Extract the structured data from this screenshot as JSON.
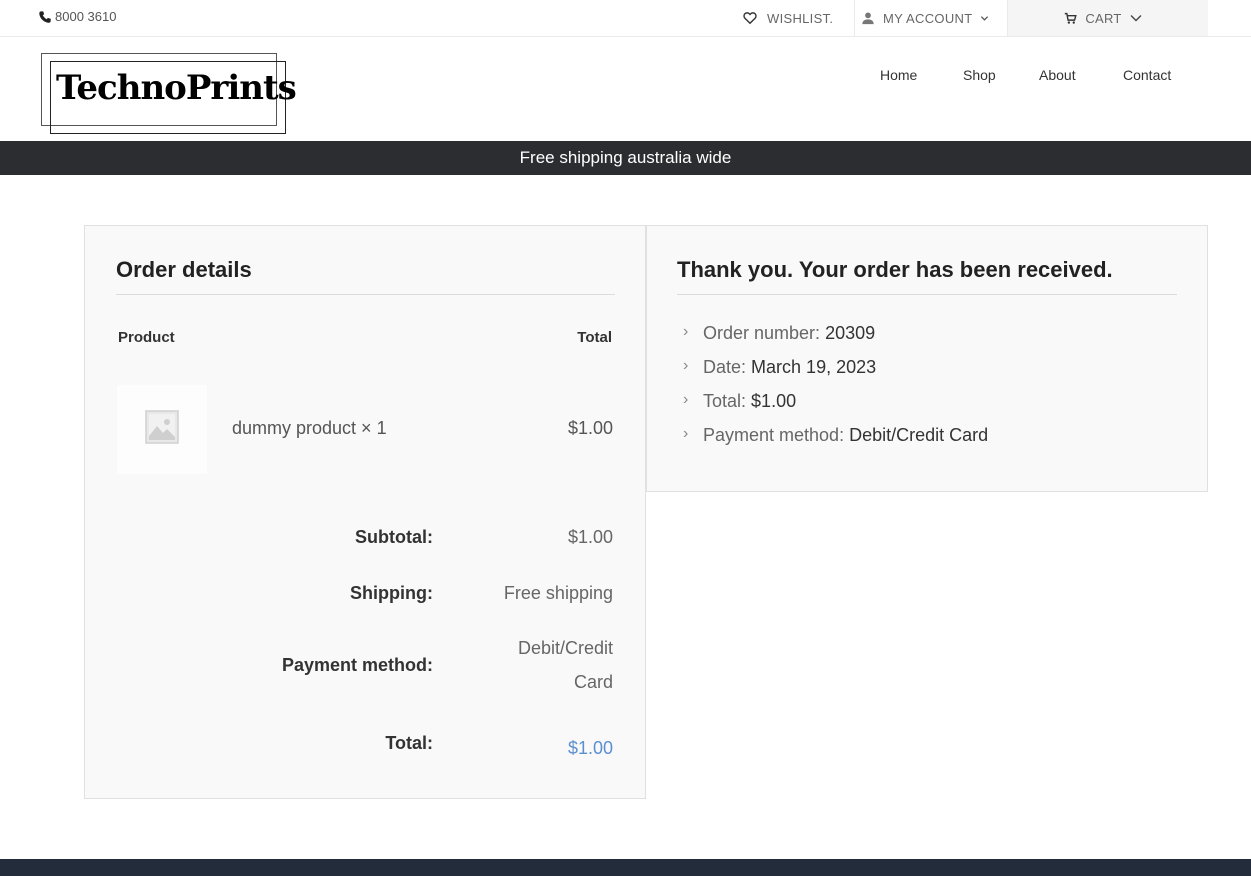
{
  "topbar": {
    "phone": "8000 3610",
    "wishlist_label": "WISHLIST.",
    "account_label": "MY ACCOUNT",
    "cart_label": "CART"
  },
  "header": {
    "logo_text": "TechnoPrints",
    "nav": [
      "Home",
      "Shop",
      "About",
      "Contact"
    ]
  },
  "banner": {
    "text": "Free shipping australia wide"
  },
  "order_details": {
    "title": "Order details",
    "col_product": "Product",
    "col_total": "Total",
    "item": {
      "name": "dummy product × 1",
      "total": "$1.00"
    },
    "rows": [
      {
        "label": "Subtotal:",
        "value": "$1.00"
      },
      {
        "label": "Shipping:",
        "value": "Free shipping"
      },
      {
        "label": "Payment method:",
        "value_line1": "Debit/Credit",
        "value_line2": "Card"
      },
      {
        "label": "Total:",
        "value": "$1.00"
      }
    ]
  },
  "confirmation": {
    "title": "Thank you. Your order has been received.",
    "items": [
      {
        "label": "Order number:",
        "value": "20309"
      },
      {
        "label": "Date:",
        "value": "March 19, 2023"
      },
      {
        "label": "Total:",
        "value": "$1.00"
      },
      {
        "label": "Payment method:",
        "value": "Debit/Credit Card"
      }
    ]
  },
  "colors": {
    "banner_bg": "#2b2d31",
    "footer_bg": "#232c3b",
    "link_blue": "#5b8fd0"
  },
  "icons": {
    "phone": "phone-icon",
    "wishlist": "heart-icon",
    "account": "user-icon",
    "cart": "cart-icon",
    "placeholder": "image-placeholder-icon"
  }
}
